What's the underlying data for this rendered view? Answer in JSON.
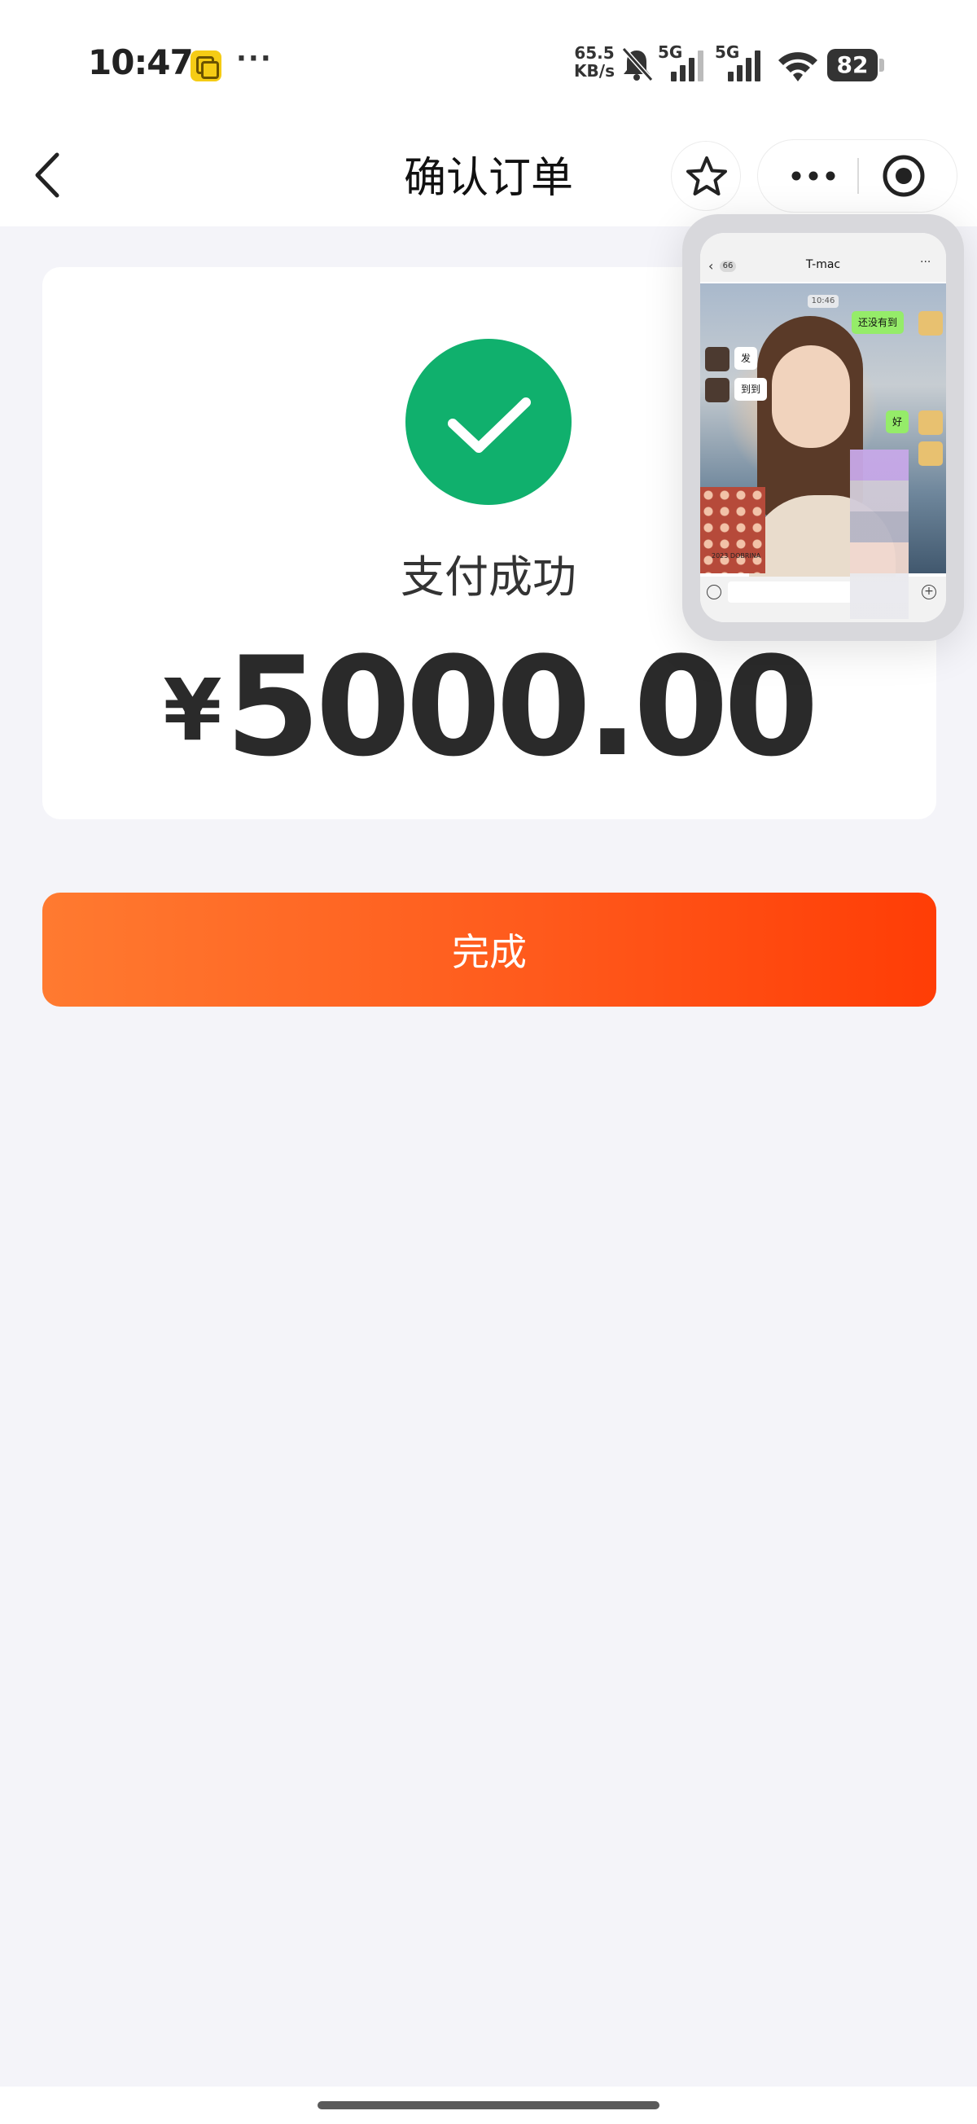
{
  "status_bar": {
    "time": "10:47",
    "dots": "···",
    "speed_value": "65.5",
    "speed_unit": "KB/s",
    "sim1_label": "5G",
    "sim2_label": "5G",
    "battery": "82",
    "icons": [
      "app-badge-icon",
      "mute-icon",
      "signal-icon",
      "signal-icon",
      "wifi-icon",
      "battery-icon"
    ]
  },
  "nav": {
    "title": "确认订单",
    "icons": [
      "back-icon",
      "star-icon",
      "more-icon",
      "close-target-icon"
    ]
  },
  "result": {
    "status": "支付成功",
    "currency": "¥",
    "amount": "5000.00",
    "icon": "check-circle-icon",
    "accent_color": "#10b06d"
  },
  "actions": {
    "done_label": "完成",
    "button_color": "#ff5a1c"
  },
  "floating_window": {
    "chat_title": "T-mac",
    "unread_badge": "66",
    "time_label": "10:46",
    "messages": [
      {
        "from": "me",
        "text": "还没有到"
      },
      {
        "from": "other",
        "text": "发"
      },
      {
        "from": "other",
        "text": "到到"
      },
      {
        "from": "me",
        "text": "好"
      }
    ],
    "tin_text": "2023 DOBRINA"
  }
}
